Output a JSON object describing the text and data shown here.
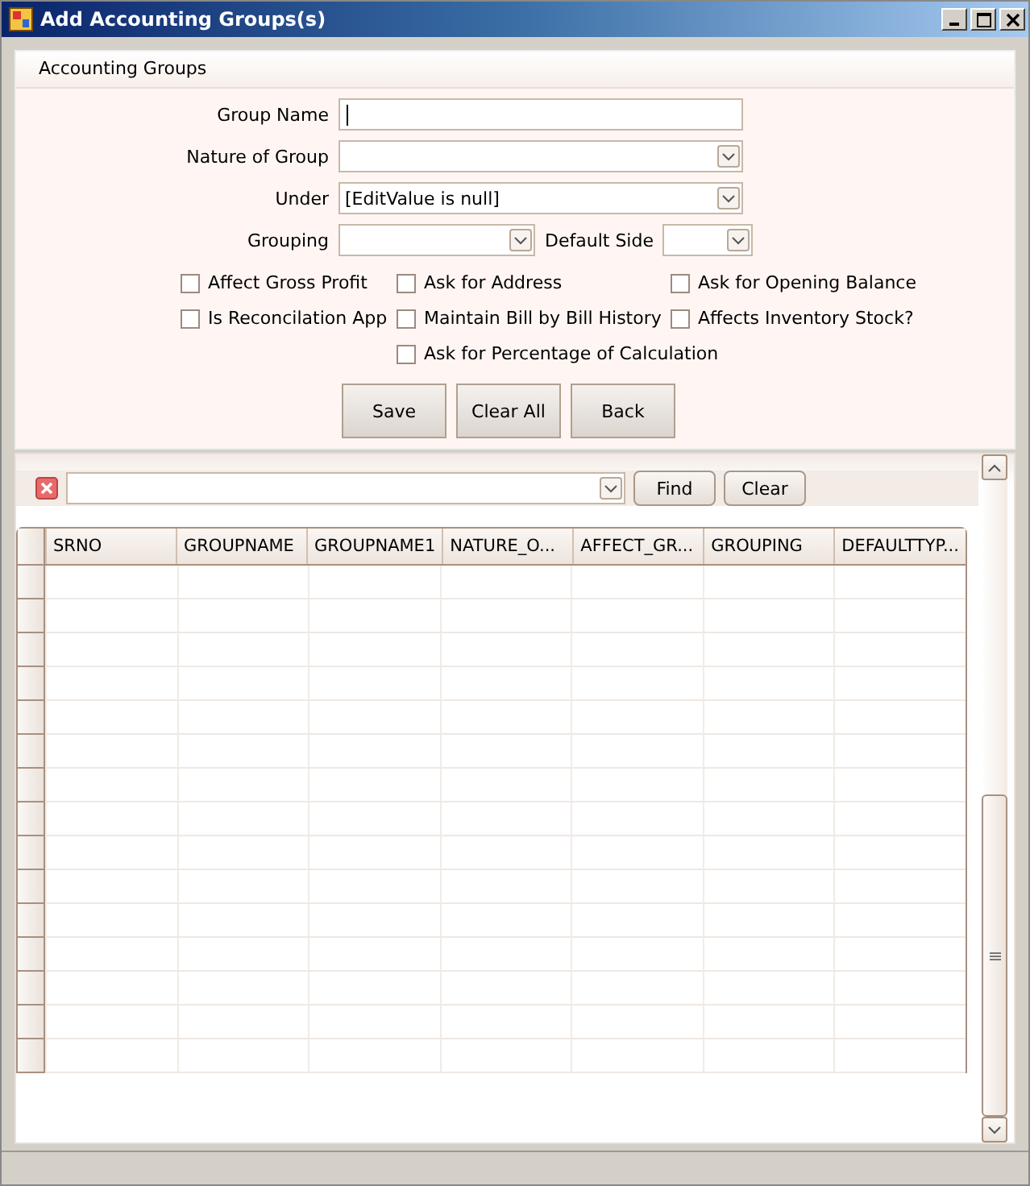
{
  "window": {
    "title": "Add Accounting Groups(s)"
  },
  "panel": {
    "title": "Accounting Groups"
  },
  "fields": [
    {
      "label": "Group Name",
      "kind": "text",
      "focused": true
    },
    {
      "label": "Nature of Group",
      "kind": "combo"
    },
    {
      "label": "Under",
      "kind": "combo",
      "value": "[EditValue is null]"
    }
  ],
  "grouping": {
    "label": "Grouping"
  },
  "default_side": {
    "label": "Default Side"
  },
  "checkboxes": [
    {
      "label": "Affect Gross Profit",
      "checked": false
    },
    {
      "label": "Ask for Address",
      "checked": false
    },
    {
      "label": "Ask for Opening Balance",
      "checked": false
    },
    {
      "label": "Is Reconcilation App",
      "checked": false
    },
    {
      "label": "Maintain Bill by Bill History",
      "checked": false
    },
    {
      "label": "Affects Inventory Stock?",
      "checked": false
    },
    {
      "label": "Ask for Percentage of Calculation",
      "checked": false
    }
  ],
  "buttons": [
    "Save",
    "Clear All",
    "Back"
  ],
  "filter": {
    "buttons": [
      "Find",
      "Clear"
    ]
  },
  "table": {
    "columns": [
      "SRNO",
      "GROUPNAME",
      "GROUPNAME1",
      "NATURE_O...",
      "AFFECT_GR...",
      "GROUPING",
      "DEFAULTTYP..."
    ]
  }
}
